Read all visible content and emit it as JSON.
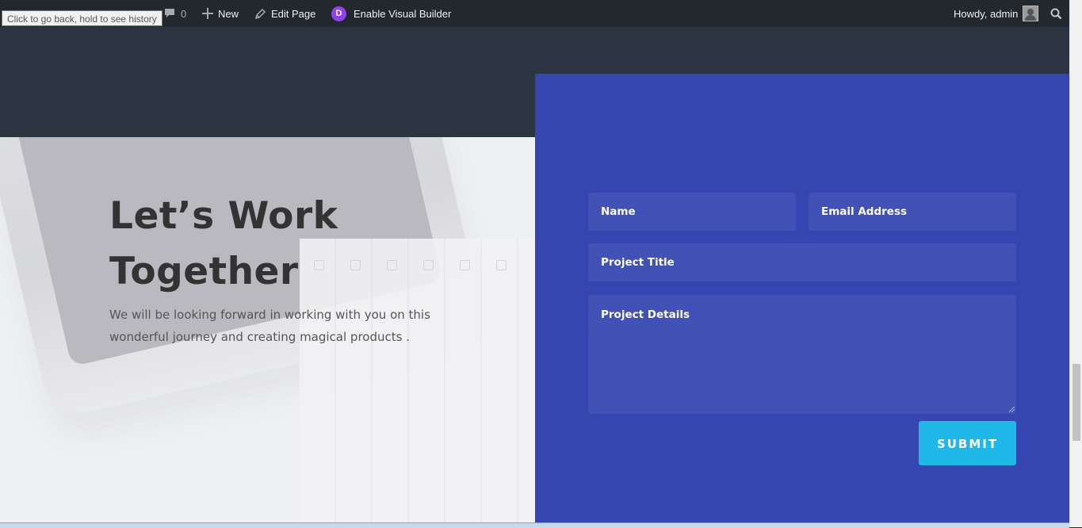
{
  "admin_bar": {
    "tooltip": "Click to go back, hold to see history",
    "comments_count": "0",
    "new_label": "New",
    "edit_page_label": "Edit Page",
    "divi_badge": "D",
    "visual_builder_label": "Enable Visual Builder",
    "greeting": "Howdy, admin",
    "icons": [
      "comment-icon",
      "plus-icon",
      "pencil-icon",
      "divi-icon",
      "avatar",
      "search-icon"
    ]
  },
  "hero": {
    "heading": "Let’s Work Together",
    "subtext": "We will be looking forward in working with you on this wonderful journey and creating magical products ."
  },
  "form": {
    "name_placeholder": "Name",
    "email_placeholder": "Email Address",
    "title_placeholder": "Project Title",
    "details_placeholder": "Project Details",
    "submit_label": "SUBMIT"
  },
  "colors": {
    "admin_bar": "#23282d",
    "dark_section": "#2c3441",
    "form_panel": "#3646b1",
    "field_bg": "#4151b5",
    "submit_button": "#1fb7e8",
    "divi_purple": "#8f42ec"
  }
}
